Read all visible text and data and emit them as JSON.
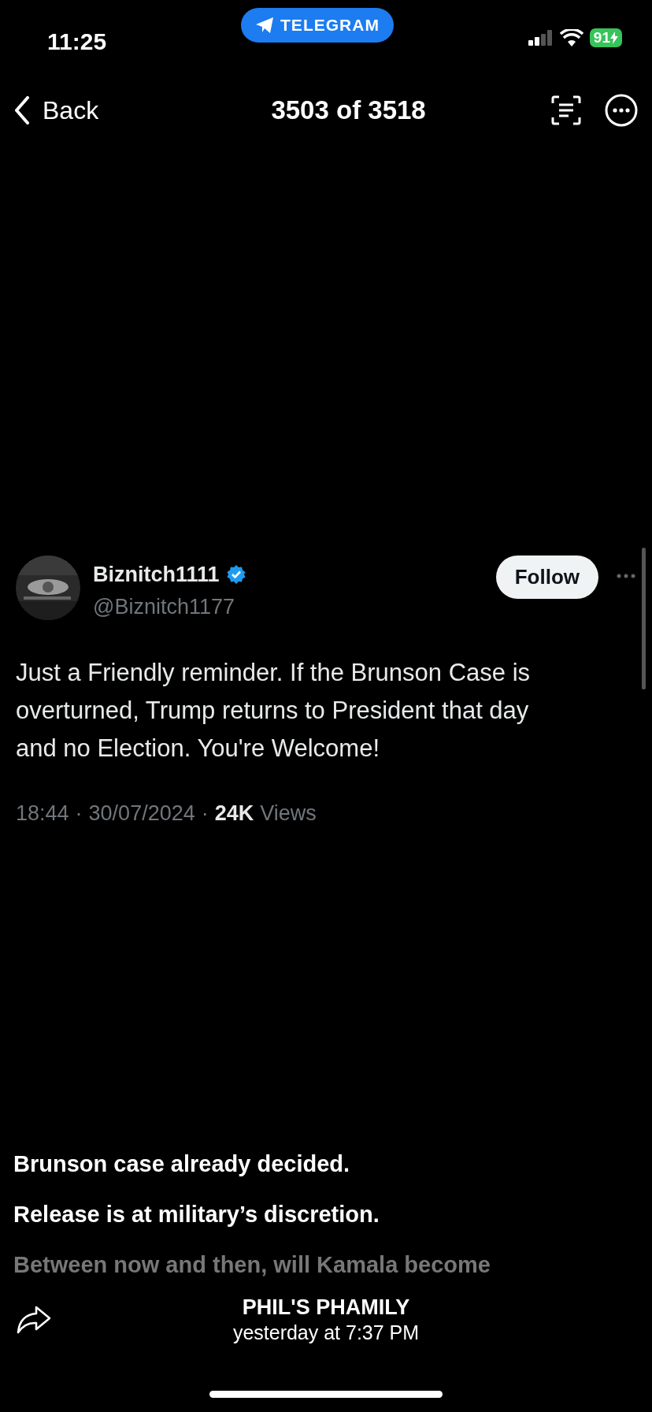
{
  "status_bar": {
    "time": "11:25",
    "app_pill": "TELEGRAM",
    "battery": "91"
  },
  "nav": {
    "back": "Back",
    "title": "3503 of 3518"
  },
  "tweet": {
    "name": "Biznitch1111",
    "verified": true,
    "handle": "@Biznitch1177",
    "follow": "Follow",
    "text": "Just a Friendly reminder. If the Brunson Case is overturned, Trump returns to President that day and no Election. You're Welcome!",
    "meta": [
      {
        "kind": "text",
        "text": "18:44"
      },
      {
        "kind": "sep",
        "text": "·"
      },
      {
        "kind": "text",
        "text": "30/07/2024"
      },
      {
        "kind": "sep",
        "text": "·"
      },
      {
        "kind": "strong",
        "text": "24K"
      },
      {
        "kind": "text",
        "text": "Views"
      }
    ]
  },
  "caption": [
    {
      "text": "Brunson case already decided.",
      "faded": false
    },
    {
      "text": "Release is at military’s discretion.",
      "faded": false
    },
    {
      "text": "Between now and then, will Kamala become",
      "faded": true
    }
  ],
  "footer": {
    "sender": "PHIL'S PHAMILY",
    "date": "yesterday at 7:37 PM"
  }
}
